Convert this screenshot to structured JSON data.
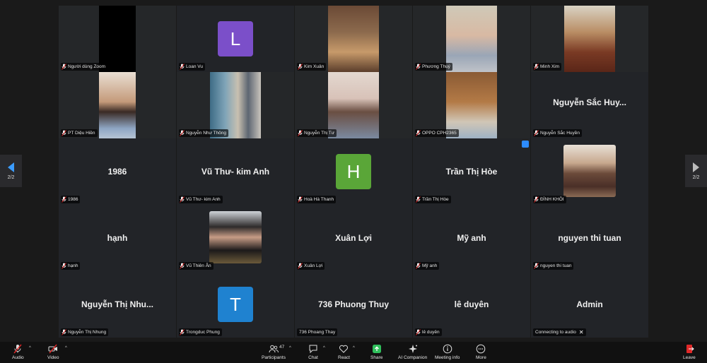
{
  "page": {
    "indicator": "2/2"
  },
  "tiles": [
    {
      "label": "Người dùng Zoom"
    },
    {
      "label": "Loan Vu",
      "initial": "L",
      "color": "#7b4fc9"
    },
    {
      "label": "Kim Xuân"
    },
    {
      "label": "Phương Thuý"
    },
    {
      "label": "Minh Xim"
    },
    {
      "label": "PT Diệu Hiền"
    },
    {
      "label": "Nguyễn Như Thông"
    },
    {
      "label": "Nguyễn Thị Tư"
    },
    {
      "label": "OPPO CPH2365"
    },
    {
      "label": "Nguyễn Sắc Huyền",
      "display": "Nguyễn Sắc Huy..."
    },
    {
      "label": "1986",
      "display": "1986"
    },
    {
      "label": "Vũ Thư- kim Anh",
      "display": "Vũ Thư- kim Anh"
    },
    {
      "label": "Hoà Hà Thanh",
      "initial": "H",
      "color": "#5aa638"
    },
    {
      "label": "Trần Thị Hòe",
      "display": "Trần Thị Hòe"
    },
    {
      "label": "ĐÌNH KHÔI"
    },
    {
      "label": "hạnh",
      "display": "hạnh"
    },
    {
      "label": "Vũ Thiên Ân"
    },
    {
      "label": "Xuân Lợi",
      "display": "Xuân Lợi"
    },
    {
      "label": "Mỹ anh",
      "display": "Mỹ anh"
    },
    {
      "label": "nguyen thi tuan",
      "display": "nguyen thi tuan"
    },
    {
      "label": "Nguyễn Thị Nhung",
      "display": "Nguyễn Thị Nhu..."
    },
    {
      "label": "Trongduc Phung",
      "initial": "T",
      "color": "#1f82d0"
    },
    {
      "label": "736 Phoang Thay",
      "display": "736 Phuong Thuy"
    },
    {
      "label": "lê duyên",
      "display": "lê duyên"
    },
    {
      "label": "Connecting to audio",
      "display": "Admin"
    }
  ],
  "toolbar": {
    "audio": "Audio",
    "video": "Video",
    "participants": "Participants",
    "participants_count": "47",
    "chat": "Chat",
    "react": "React",
    "share": "Share",
    "ai_companion": "AI Companion",
    "meeting_info": "Meeting info",
    "more": "More",
    "leave": "Leave"
  },
  "colors": {
    "accent": "#2d8cff",
    "share_green": "#2fbf5b",
    "leave_red": "#e02828"
  }
}
